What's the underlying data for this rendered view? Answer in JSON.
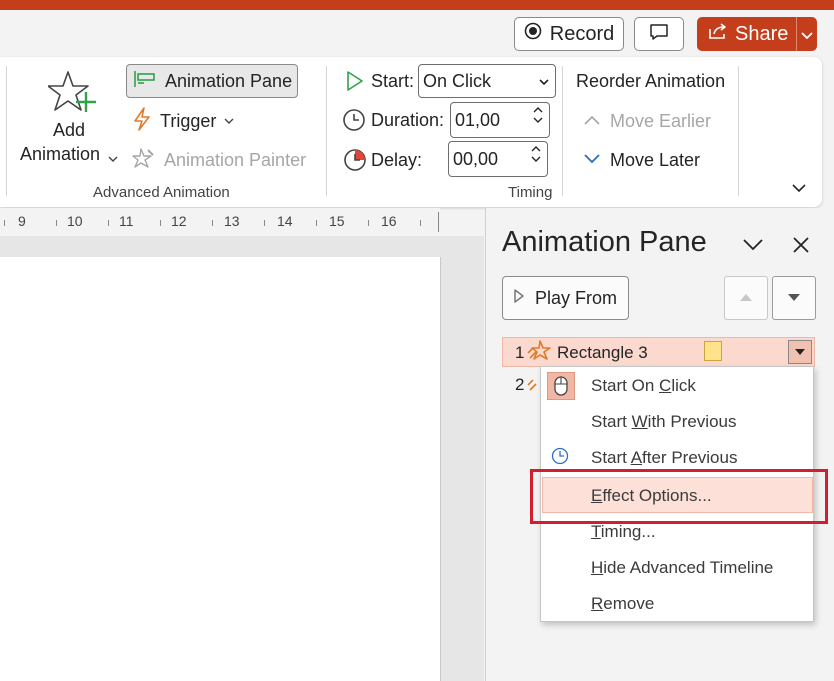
{
  "titlebar": {
    "accent": "#c43e1c"
  },
  "top_actions": {
    "record_label": "Record",
    "share_label": "Share"
  },
  "ribbon": {
    "add_animation": {
      "line1": "Add",
      "line2": "Animation"
    },
    "animation_pane_label": "Animation Pane",
    "trigger_label": "Trigger",
    "animation_painter_label": "Animation Painter",
    "advanced_group_label": "Advanced Animation",
    "start_label": "Start:",
    "start_value": "On Click",
    "duration_label": "Duration:",
    "duration_value": "01,00",
    "delay_label": "Delay:",
    "delay_value": "00,00",
    "timing_group_label": "Timing",
    "reorder_title": "Reorder Animation",
    "move_earlier_label": "Move Earlier",
    "move_later_label": "Move Later"
  },
  "ruler": {
    "numbers": [
      "9",
      "10",
      "11",
      "12",
      "13",
      "14",
      "15",
      "16"
    ]
  },
  "animation_pane": {
    "title": "Animation Pane",
    "play_from_label": "Play From",
    "items": [
      {
        "num": "1",
        "label": "Rectangle 3"
      },
      {
        "num": "2",
        "label": ""
      }
    ]
  },
  "context_menu": {
    "start_on_click": {
      "pre": "Start On ",
      "u": "C",
      "post": "lick"
    },
    "start_with_previous": {
      "pre": "Start ",
      "u": "W",
      "post": "ith Previous"
    },
    "start_after_previous": {
      "pre": "Start ",
      "u": "A",
      "post": "fter Previous"
    },
    "effect_options": {
      "pre": "",
      "u": "E",
      "post": "ffect Options..."
    },
    "timing": {
      "pre": "",
      "u": "T",
      "post": "iming..."
    },
    "hide_advanced_timeline": {
      "pre": "",
      "u": "H",
      "post": "ide Advanced Timeline"
    },
    "remove": {
      "pre": "",
      "u": "R",
      "post": "emove"
    }
  },
  "colors": {
    "brand": "#c43e1c",
    "selection": "#fbd9cf",
    "highlight_box": "#d0202e",
    "icon_orange": "#e07b28",
    "icon_green": "#2fa24a",
    "icon_blue": "#2b6cc4"
  }
}
